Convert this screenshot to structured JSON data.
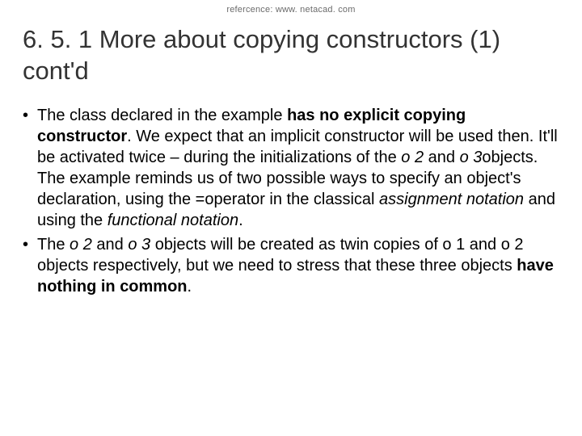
{
  "reference": "refercence: www. netacad. com",
  "title": "6. 5. 1 More about copying constructors (1) cont'd",
  "bullet1": {
    "seg1": "The class declared in the example ",
    "seg2_bold": "has no explicit copying constructor",
    "seg3": ". We expect that an implicit constructor will be used then. It'll be activated twice – during the initializations of the ",
    "seg4_italic": "o 2",
    "seg5": " and ",
    "seg6_italic": "o 3",
    "seg7": "objects. The example reminds us of two possible ways to specify an object's declaration, using the =operator in the classical ",
    "seg8_italic": "assignment notation",
    "seg9": " and using the ",
    "seg10_italic": "functional notation",
    "seg11": "."
  },
  "bullet2": {
    "seg1": "The ",
    "seg2_italic": "o 2",
    "seg3": " and ",
    "seg4_italic": "o 3",
    "seg5": " objects will be created as twin copies of o 1 and o 2 objects respectively, but we need to stress that these three objects ",
    "seg6_bold": "have nothing in common",
    "seg7": "."
  }
}
